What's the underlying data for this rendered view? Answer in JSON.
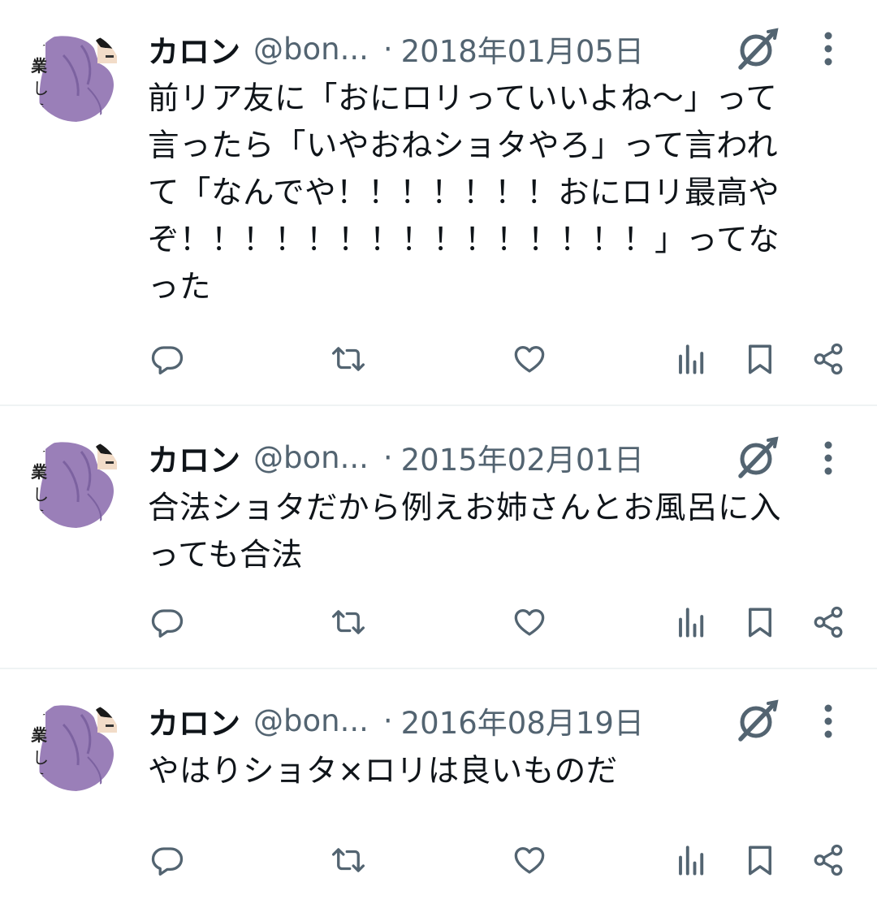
{
  "tweets": [
    {
      "author_name": "カロン",
      "handle": "@bon...",
      "separator": "·",
      "date": "2018年01月05日",
      "text": "前リア友に「おにロリっていいよね〜」って\n言ったら「いやおねショタやろ」って言われ\nて「なんでや！！！！！！！おにロリ最高や\nぞ！！！！！！！！！！！！！！！」ってな\nった"
    },
    {
      "author_name": "カロン",
      "handle": "@bon...",
      "separator": "·",
      "date": "2015年02月01日",
      "text": "合法ショタだから例えお姉さんとお風呂に入\nっても合法"
    },
    {
      "author_name": "カロン",
      "handle": "@bon...",
      "separator": "·",
      "date": "2016年08月19日",
      "text": "やはりショタ×ロリは良いものだ"
    }
  ],
  "avatar_lettering": "手業しえ",
  "icons": [
    "grok-icon",
    "more-icon",
    "reply-icon",
    "retweet-icon",
    "like-icon",
    "views-icon",
    "bookmark-icon",
    "share-icon"
  ],
  "colors": {
    "text": "#0f1419",
    "secondary": "#536471",
    "divider": "#eff3f4",
    "avatar_purple": "#9a7fb8"
  }
}
